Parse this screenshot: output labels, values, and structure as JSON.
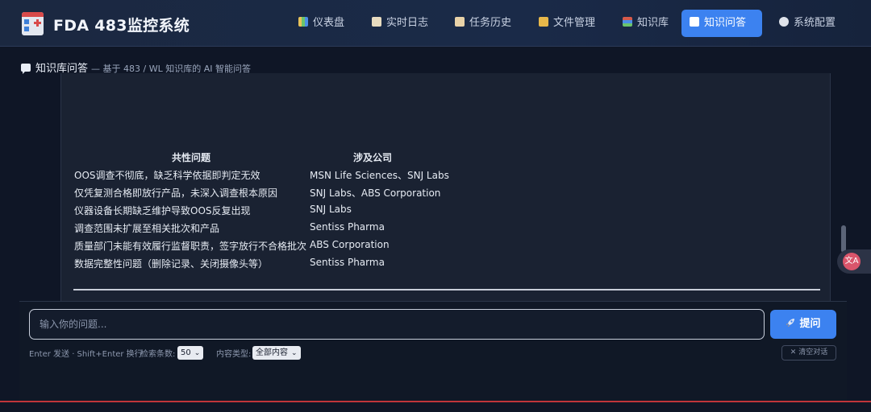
{
  "header": {
    "brand": "FDA 483监控系统",
    "nav": [
      {
        "label": "仪表盘",
        "icon": "bar-chart-icon",
        "active": false
      },
      {
        "label": "实时日志",
        "icon": "clipboard-icon",
        "active": false
      },
      {
        "label": "任务历史",
        "icon": "scroll-icon",
        "active": false
      },
      {
        "label": "文件管理",
        "icon": "folder-icon",
        "active": false
      },
      {
        "label": "知识库",
        "icon": "books-icon",
        "active": false
      },
      {
        "label": "知识问答",
        "icon": "speech-bubble-icon",
        "active": true
      },
      {
        "label": "系统配置",
        "icon": "gear-icon",
        "active": false
      }
    ]
  },
  "section": {
    "title": "知识库问答",
    "subtitle": "— 基于 483 / WL 知识库的 AI 智能问答"
  },
  "answer_table": {
    "headers": [
      "共性问题",
      "涉及公司"
    ],
    "rows": [
      [
        "OOS调查不彻底，缺乏科学依据即判定无效",
        "MSN Life Sciences、SNJ Labs"
      ],
      [
        "仅凭复测合格即放行产品，未深入调查根本原因",
        "SNJ Labs、ABS Corporation"
      ],
      [
        "仪器设备长期缺乏维护导致OOS反复出现",
        "SNJ Labs"
      ],
      [
        "调查范围未扩展至相关批次和产品",
        "Sentiss Pharma"
      ],
      [
        "质量部门未能有效履行监督职责，签字放行不合格批次",
        "ABS Corporation"
      ],
      [
        "数据完整性问题（删除记录、关闭摄像头等）",
        "Sentiss Pharma"
      ]
    ]
  },
  "input": {
    "placeholder": "输入你的问题...",
    "value": "",
    "ask_label": "提问",
    "hint": "Enter 发送 · Shift+Enter 换行",
    "count_label": "检索条数:",
    "count_value": "50",
    "type_label": "内容类型:",
    "type_value": "全部内容",
    "clear_label": "✕ 清空对话"
  },
  "colors": {
    "accent": "#3c82f0",
    "bottom_line": "#c0353a"
  }
}
